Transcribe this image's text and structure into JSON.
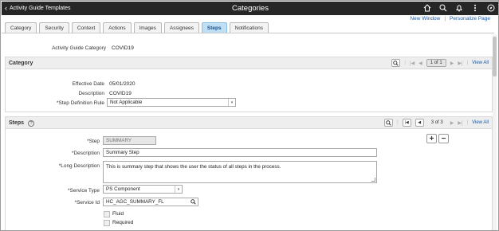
{
  "header": {
    "back_label": "Activity Guide Templates",
    "title": "Categories",
    "icons": [
      "home-icon",
      "search-icon",
      "notification-icon",
      "actions-menu-icon",
      "navbar-icon"
    ]
  },
  "links": {
    "new_window": "New Window",
    "separator": "|",
    "personalize": "Personalize Page"
  },
  "tabs": [
    {
      "label": "Category"
    },
    {
      "label": "Security"
    },
    {
      "label": "Context"
    },
    {
      "label": "Actions"
    },
    {
      "label": "Images"
    },
    {
      "label": "Assignees"
    },
    {
      "label": "Steps",
      "active": true
    },
    {
      "label": "Notifications"
    }
  ],
  "category_field": {
    "label": "Activity Guide Category",
    "value": "COVID19"
  },
  "category_section": {
    "title": "Category",
    "pager": {
      "count": "1 of 1",
      "view_all": "View All"
    },
    "effective_date_label": "Effective Date",
    "effective_date": "05/01/2020",
    "description_label": "Description",
    "description": "COVID19",
    "step_rule_label": "*Step Definition Rule",
    "step_rule": "Not Applicable"
  },
  "steps_section": {
    "title": "Steps",
    "pager": {
      "count": "3 of 3",
      "view_all": "View All"
    },
    "step_label": "*Step",
    "step": "SUMMARY",
    "description_label": "*Description",
    "description": "Summary Step",
    "long_description_label": "*Long Description",
    "long_description": "This is summary step that shows the user the status of all steps in the process.",
    "service_type_label": "*Service Type",
    "service_type": "PS Component",
    "service_id_label": "*Service Id",
    "service_id": "HC_AGC_SUMMARY_FL",
    "fluid_label": "Fluid",
    "required_label": "Required",
    "add": "+",
    "remove": "−"
  },
  "colors": {
    "header_bg": "#262626",
    "active_tab": "#bfe0f4",
    "link": "#1a5aa6",
    "section_bg": "#eeeeee"
  }
}
